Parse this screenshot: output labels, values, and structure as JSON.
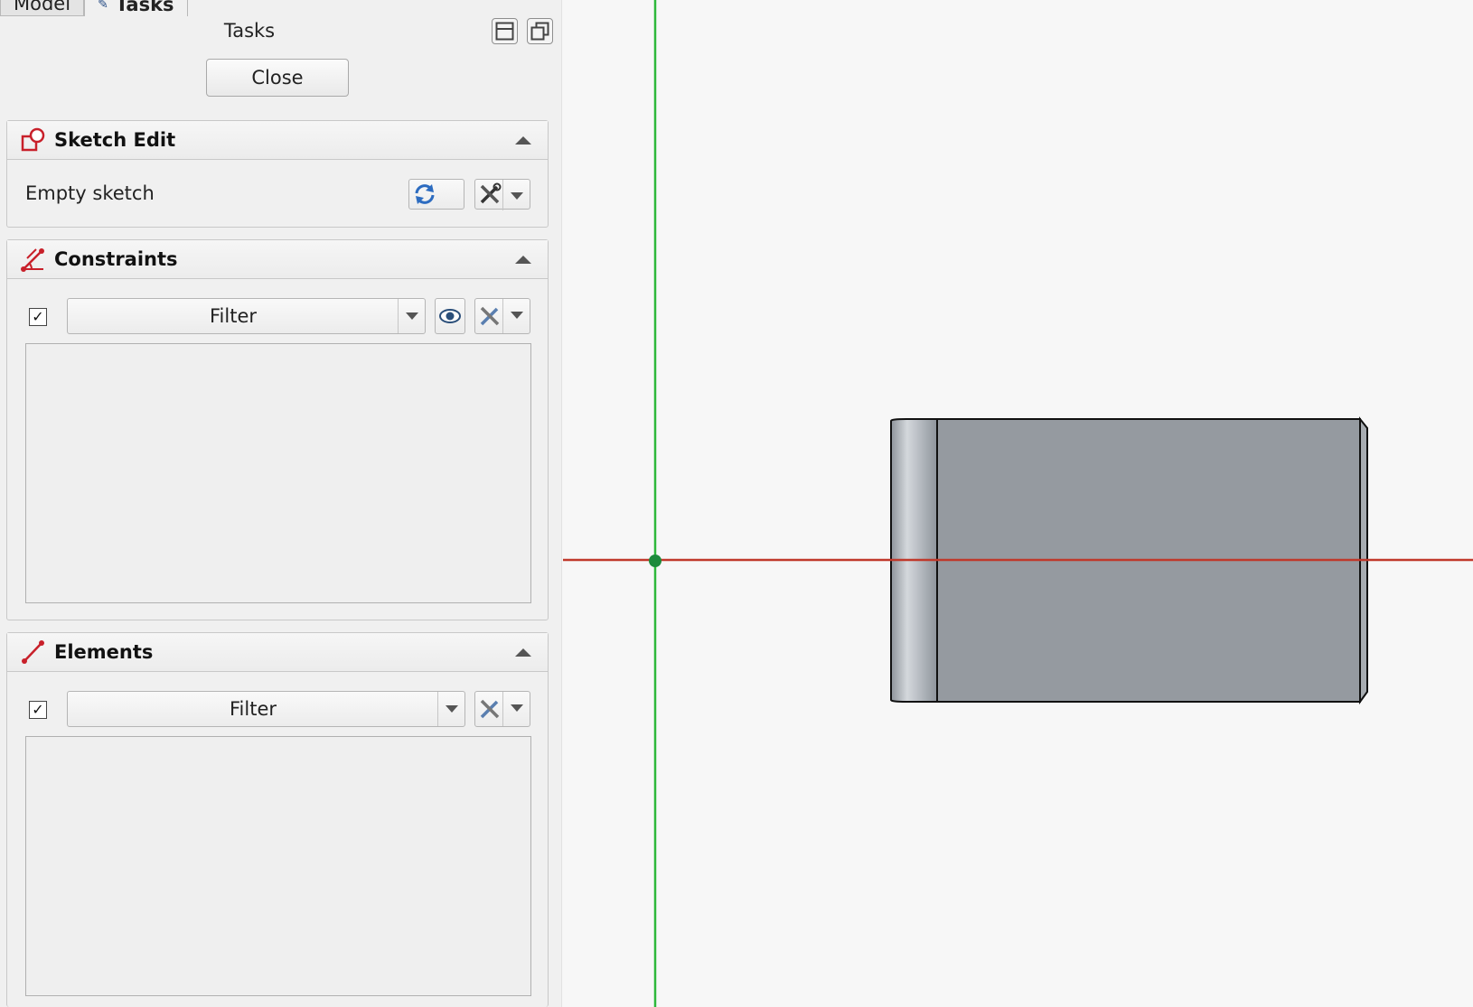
{
  "tabs": [
    {
      "label": "Model",
      "active": false
    },
    {
      "label": "Tasks",
      "active": true
    }
  ],
  "panel": {
    "title": "Tasks",
    "close_label": "Close"
  },
  "sketch_edit": {
    "title": "Sketch Edit",
    "status": "Empty sketch"
  },
  "constraints": {
    "title": "Constraints",
    "filter_checked": true,
    "filter_label": "Filter"
  },
  "elements": {
    "title": "Elements",
    "filter_checked": true,
    "filter_label": "Filter"
  },
  "icons": {
    "sketch": "sketch-edit-icon",
    "constraints": "constraints-icon",
    "elements": "line-element-icon",
    "refresh": "refresh-icon",
    "settings": "tools-icon",
    "visibility": "eye-icon"
  },
  "colors": {
    "x_axis": "#c0392b",
    "y_axis": "#2eb83a",
    "origin": "#1e8a3c",
    "solid_face": "#959aa0",
    "panel_bg": "#f0f0f0",
    "view_bg": "#f7f7f7"
  }
}
